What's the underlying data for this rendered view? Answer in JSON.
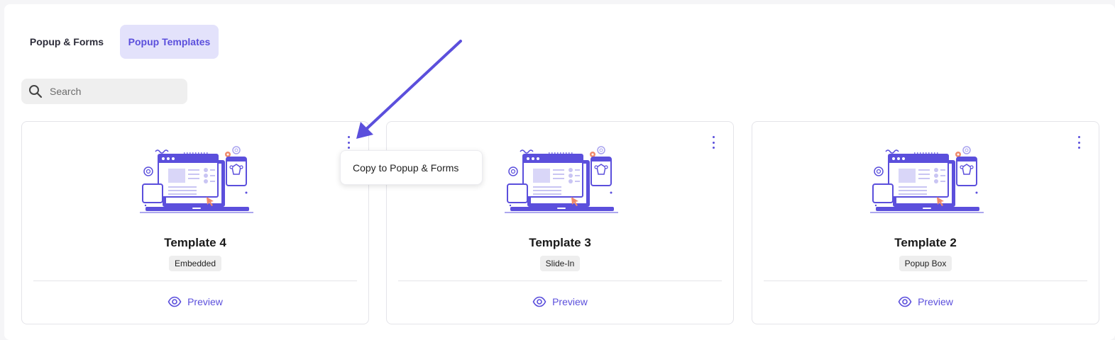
{
  "tabs": {
    "forms_label": "Popup & Forms",
    "templates_label": "Popup Templates",
    "active": "Popup Templates"
  },
  "search": {
    "placeholder": "Search",
    "value": ""
  },
  "cards": [
    {
      "title": "Template 4",
      "badge": "Embedded",
      "preview_label": "Preview"
    },
    {
      "title": "Template 3",
      "badge": "Slide-In",
      "preview_label": "Preview"
    },
    {
      "title": "Template 2",
      "badge": "Popup Box",
      "preview_label": "Preview"
    }
  ],
  "dropdown": {
    "item_label": "Copy to Popup & Forms"
  },
  "colors": {
    "accent": "#5b4fdc",
    "active_tab_bg": "#e3e2fb",
    "illustration_orange": "#f08a6a"
  },
  "icons": {
    "search": "search-icon",
    "menu": "more-vertical-icon",
    "preview": "eye-icon"
  }
}
